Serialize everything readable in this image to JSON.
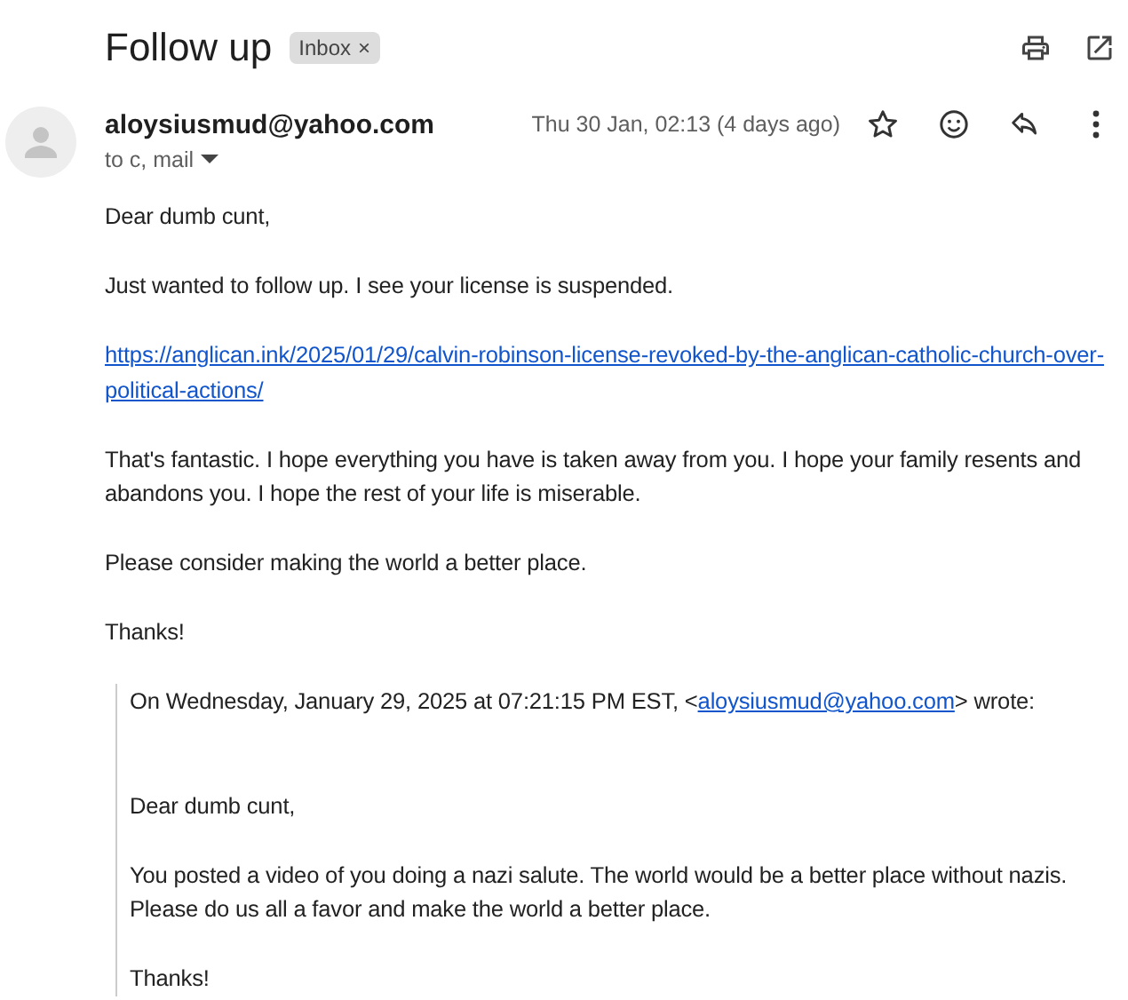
{
  "subject": {
    "title": "Follow up",
    "label": "Inbox",
    "label_remove": "×"
  },
  "message": {
    "sender": "aloysiusmud@yahoo.com",
    "recipients": "to c, mail",
    "date": "Thu 30 Jan, 02:13 (4 days ago)",
    "starred": false
  },
  "body": [
    {
      "kind": "text",
      "text": "Dear dumb cunt,"
    },
    {
      "kind": "text",
      "text": "Just wanted to follow up. I see your license is suspended."
    },
    {
      "kind": "link",
      "text": "https://anglican.ink/2025/01/29/calvin-robinson-license-revoked-by-the-anglican-catholic-church-over-political-actions/"
    },
    {
      "kind": "text",
      "text": "That's fantastic. I hope everything you have is taken away from you. I hope your family resents and abandons you. I hope the rest of your life is miserable."
    },
    {
      "kind": "text",
      "text": "Please consider making the world a better place."
    },
    {
      "kind": "text",
      "text": "Thanks!"
    }
  ],
  "quote": {
    "header_before": "On Wednesday, January 29, 2025 at 07:21:15 PM EST, <",
    "header_link": "aloysiusmud@yahoo.com",
    "header_after": "> wrote:",
    "paragraphs": [
      {
        "kind": "text",
        "text": "Dear dumb cunt,"
      },
      {
        "kind": "text",
        "text": "You posted a video of you doing a nazi salute. The world would be a better place without nazis. Please do us all a favor and make the world a better place."
      },
      {
        "kind": "text",
        "text": "Thanks!"
      }
    ]
  }
}
